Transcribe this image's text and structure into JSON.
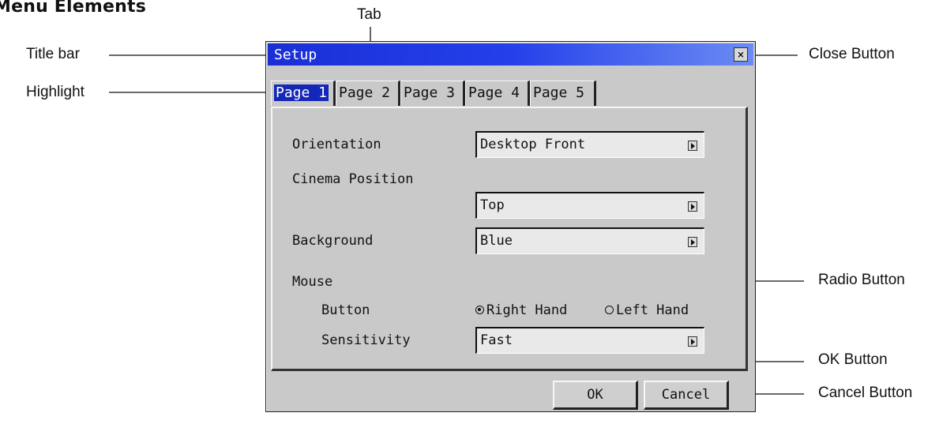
{
  "heading": "Menu Elements",
  "callouts": {
    "tab": "Tab",
    "title_bar": "Title bar",
    "highlight": "Highlight",
    "close_button": "Close Button",
    "radio_button": "Radio Button",
    "ok_button": "OK Button",
    "cancel_button": "Cancel Button"
  },
  "dialog": {
    "title": "Setup",
    "close_glyph": "×",
    "tabs": [
      {
        "label": "Page 1",
        "active": true
      },
      {
        "label": "Page 2",
        "active": false
      },
      {
        "label": "Page 3",
        "active": false
      },
      {
        "label": "Page 4",
        "active": false
      },
      {
        "label": "Page 5",
        "active": false
      }
    ],
    "orientation": {
      "label": "Orientation",
      "value": "Desktop Front"
    },
    "cinema_position": {
      "label": "Cinema Position",
      "value": "Top"
    },
    "background": {
      "label": "Background",
      "value": "Blue"
    },
    "mouse": {
      "label": "Mouse",
      "button_label": "Button",
      "right_hand": "Right Hand",
      "left_hand": "Left Hand",
      "selected": "Right Hand",
      "sensitivity_label": "Sensitivity",
      "sensitivity_value": "Fast"
    },
    "ok_label": "OK",
    "cancel_label": "Cancel"
  },
  "colors": {
    "title_bar": "#1a2fd6",
    "highlight": "#1327b8",
    "dialog_bg": "#c9c9c9"
  }
}
